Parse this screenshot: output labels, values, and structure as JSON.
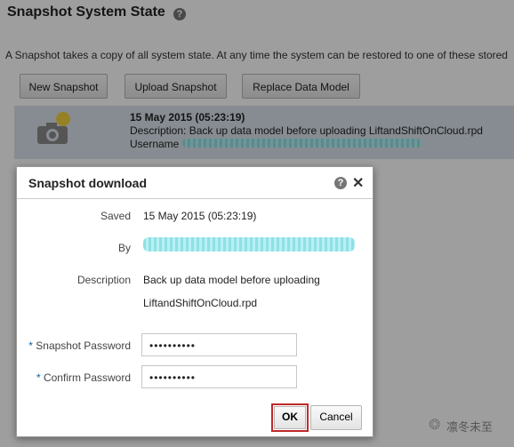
{
  "page": {
    "title": "Snapshot System State",
    "description": "A Snapshot takes a copy of all system state. At any time the system can be restored to one of these stored"
  },
  "toolbar": {
    "new_snapshot": "New Snapshot",
    "upload_snapshot": "Upload Snapshot",
    "replace_data_model": "Replace Data Model"
  },
  "snapshot": {
    "date": "15 May 2015 (05:23:19)",
    "description": "Description: Back up data model before uploading LiftandShiftOnCloud.rpd",
    "username_label": "Username"
  },
  "dialog": {
    "title": "Snapshot download",
    "saved_label": "Saved",
    "saved_value": "15 May 2015 (05:23:19)",
    "by_label": "By",
    "description_label": "Description",
    "description_line1": "Back up data model before uploading",
    "description_line2": "LiftandShiftOnCloud.rpd",
    "snapshot_password_label": "Snapshot Password",
    "snapshot_password_value": "••••••••••",
    "confirm_password_label": "Confirm Password",
    "confirm_password_value": "••••••••••",
    "required_marker": "*",
    "ok_label": "OK",
    "cancel_label": "Cancel"
  },
  "watermark": {
    "text": "凛冬未至"
  },
  "icons": {
    "help": "?",
    "close": "✕",
    "wechat": "❂"
  }
}
